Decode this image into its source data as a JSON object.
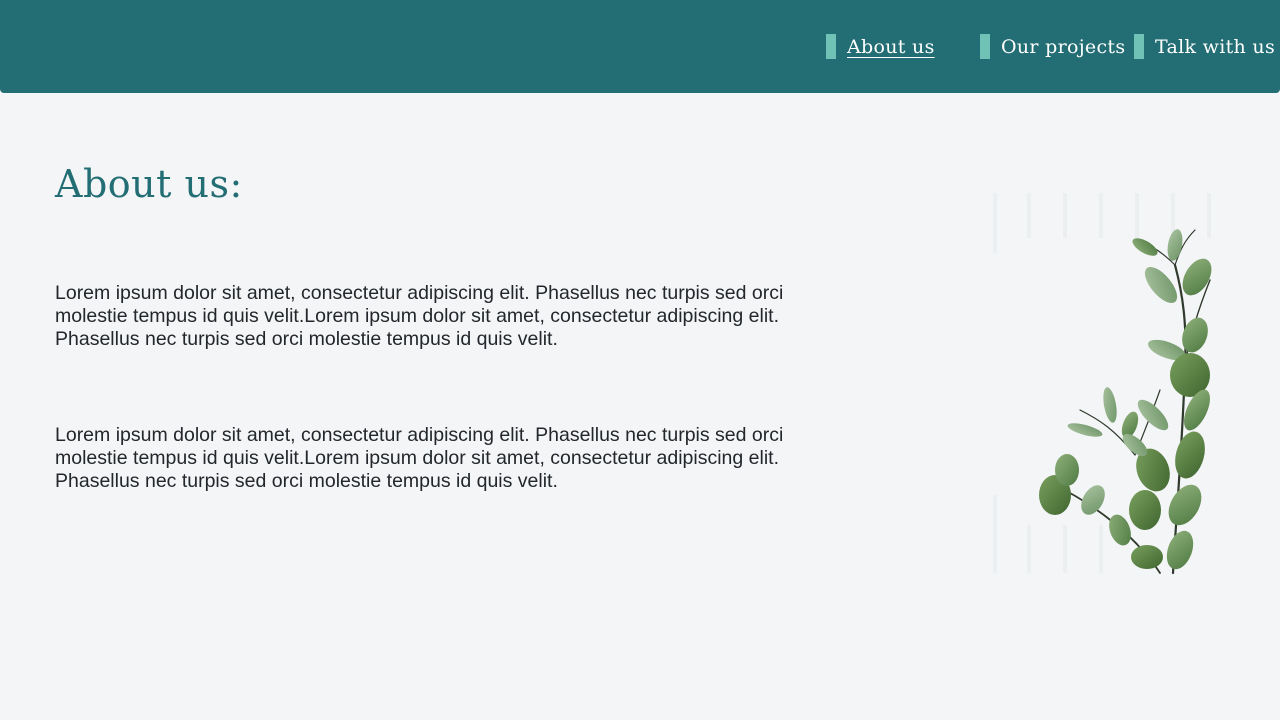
{
  "nav": {
    "items": [
      {
        "label": "About us",
        "active": true
      },
      {
        "label": "Our projects",
        "active": false
      },
      {
        "label": "Talk with us",
        "active": false
      }
    ]
  },
  "main": {
    "title": "About us:",
    "paragraphs": [
      "Lorem ipsum dolor sit amet, consectetur adipiscing elit. Phasellus nec turpis sed orci molestie tempus id quis velit.Lorem ipsum dolor sit amet, consectetur adipiscing elit. Phasellus nec turpis sed orci molestie tempus id quis velit.",
      "Lorem ipsum dolor sit amet, consectetur adipiscing elit. Phasellus nec turpis sed orci molestie tempus id quis velit.Lorem ipsum dolor sit amet, consectetur adipiscing elit. Phasellus nec turpis sed orci molestie tempus id quis velit."
    ]
  },
  "colors": {
    "header_bg": "#236e74",
    "accent": "#6fc2b5",
    "page_bg": "#f4f5f7",
    "title": "#236e74",
    "body_text": "#23272b"
  }
}
